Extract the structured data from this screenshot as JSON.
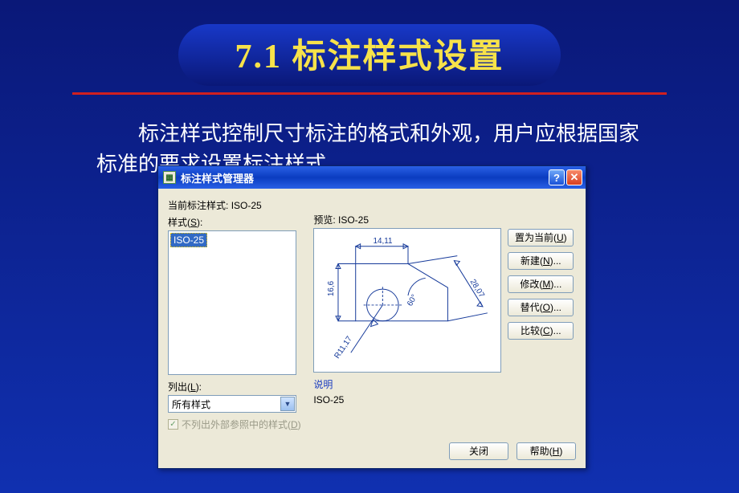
{
  "slide": {
    "title": "7.1 标注样式设置",
    "body": "标注样式控制尺寸标注的格式和外观，用户应根据国家标准的要求设置标注样式。"
  },
  "dialog": {
    "title": "标注样式管理器",
    "current_style_label": "当前标注样式:",
    "current_style_value": "ISO-25",
    "styles_label": "样式(S):",
    "style_items": [
      "ISO-25"
    ],
    "preview_label": "预览:",
    "preview_value": "ISO-25",
    "listout_label": "列出(L):",
    "listout_value": "所有样式",
    "xref_checkbox": "不列出外部参照中的样式(D)",
    "xref_checked": true,
    "desc_label": "说明",
    "desc_text": "ISO-25",
    "buttons": {
      "set_current": "置为当前(U)",
      "new": "新建(N)...",
      "modify": "修改(M)...",
      "override": "替代(O)...",
      "compare": "比较(C)...",
      "close": "关闭",
      "help": "帮助(H)"
    },
    "preview_dims": {
      "top": "14,11",
      "left": "16,6",
      "right": "28,07",
      "angle": "60°",
      "radius": "R11,17"
    }
  }
}
